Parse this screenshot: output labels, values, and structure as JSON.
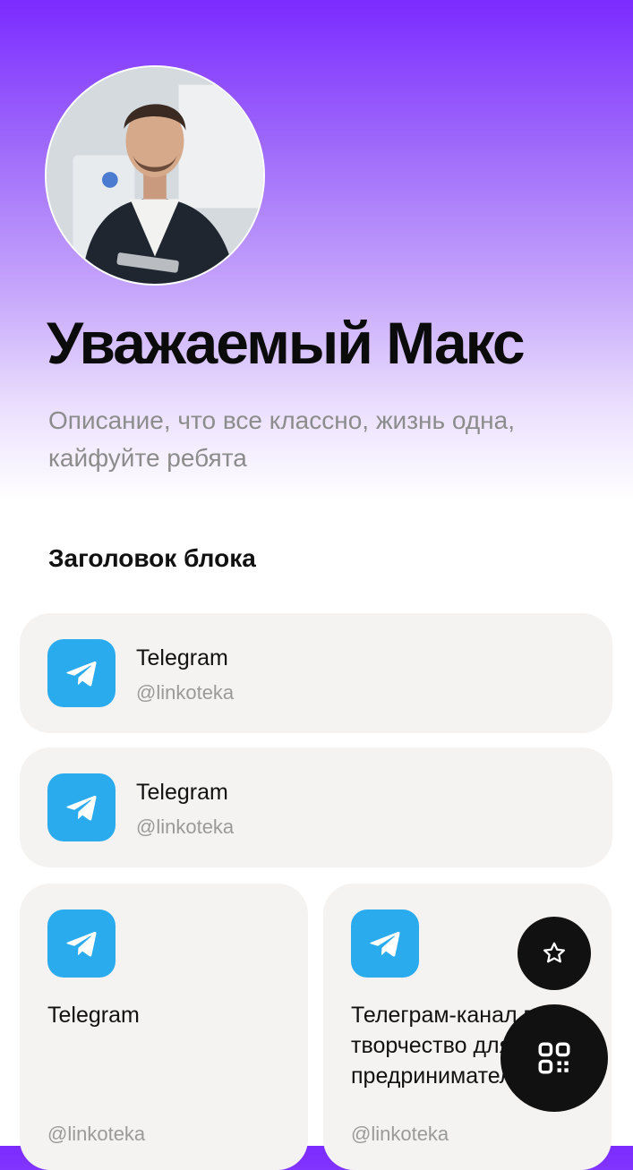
{
  "profile": {
    "name": "Уважаемый Макс",
    "description": "Описание, что все классно, жизнь одна, кайфуйте ребята"
  },
  "block": {
    "title": "Заголовок блока",
    "links": [
      {
        "icon": "telegram-icon",
        "title": "Telegram",
        "handle": "@linkoteka"
      },
      {
        "icon": "telegram-icon",
        "title": "Telegram",
        "handle": "@linkoteka"
      }
    ],
    "tiles": [
      {
        "icon": "telegram-icon",
        "title": "Telegram",
        "handle": "@linkoteka"
      },
      {
        "icon": "telegram-icon",
        "title": "Телеграм-канал про творчество для предринимателей",
        "handle": "@linkoteka"
      }
    ]
  },
  "actions": {
    "favorite_icon": "star-icon",
    "qr_icon": "qr-code-icon"
  },
  "colors": {
    "accent": "#7b2bff",
    "telegram": "#2aabee",
    "card_bg": "#f5f3f1",
    "fab": "#111111"
  }
}
